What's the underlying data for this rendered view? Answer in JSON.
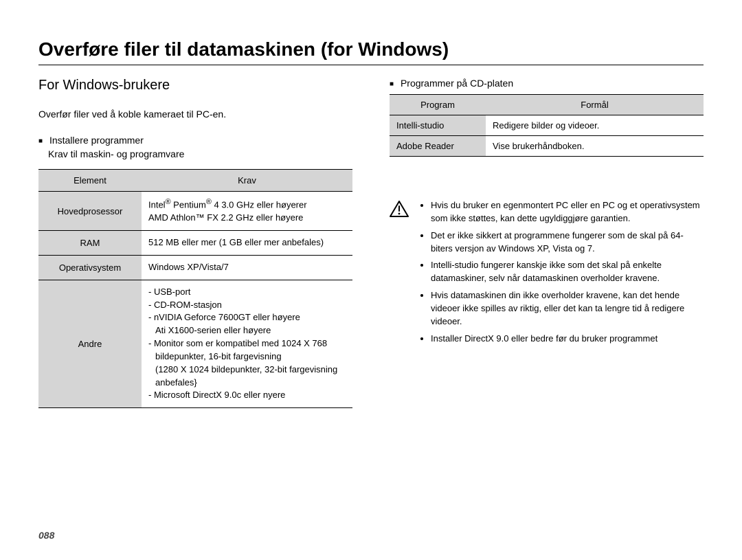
{
  "page": {
    "title": "Overføre filer til datamaskinen (for Windows)",
    "number": "088"
  },
  "left": {
    "section_heading": "For Windows-brukere",
    "intro": "Overfør filer ved å koble kameraet til PC-en.",
    "install_heading": "Installere programmer",
    "req_intro": "Krav til maskin- og programvare",
    "table": {
      "head_element": "Element",
      "head_req": "Krav",
      "rows": {
        "cpu_label": "Hovedprosessor",
        "cpu_line1a": "Intel",
        "cpu_line1b": " Pentium",
        "cpu_line1c": " 4 3.0 GHz eller høyerer",
        "cpu_line2": "AMD Athlon™ FX 2.2 GHz eller høyere",
        "ram_label": "RAM",
        "ram_value": "512 MB eller mer (1 GB eller mer anbefales)",
        "os_label": "Operativsystem",
        "os_value": "Windows XP/Vista/7",
        "other_label": "Andre",
        "other_1": "- USB-port",
        "other_2": "- CD-ROM-stasjon",
        "other_3": "- nVIDIA Geforce 7600GT eller høyere",
        "other_3b": "Ati X1600-serien eller høyere",
        "other_4": "- Monitor som er kompatibel med 1024 X 768 bildepunkter, 16-bit fargevisning",
        "other_4b": "(1280 X 1024 bildepunkter, 32-bit fargevisning anbefales}",
        "other_5": "- Microsoft DirectX 9.0c eller nyere"
      }
    }
  },
  "right": {
    "cd_heading": "Programmer på CD-platen",
    "table": {
      "head_program": "Program",
      "head_purpose": "Formål",
      "row1_label": "Intelli-studio",
      "row1_value": "Redigere bilder og videoer.",
      "row2_label": "Adobe Reader",
      "row2_value": "Vise brukerhåndboken."
    },
    "warnings": {
      "w1": "Hvis du bruker en egenmontert PC eller en PC og et operativsystem som ikke støttes, kan dette ugyldiggjøre garantien.",
      "w2": "Det er ikke sikkert at programmene fungerer som de skal på 64-biters versjon av Windows XP, Vista og 7.",
      "w3": "Intelli-studio fungerer kanskje ikke som det skal på enkelte datamaskiner, selv når datamaskinen overholder kravene.",
      "w4": "Hvis datamaskinen din ikke overholder kravene, kan det hende videoer ikke spilles av riktig, eller det kan ta lengre tid å redigere videoer.",
      "w5": "Installer DirectX 9.0 eller bedre før du bruker programmet"
    }
  }
}
